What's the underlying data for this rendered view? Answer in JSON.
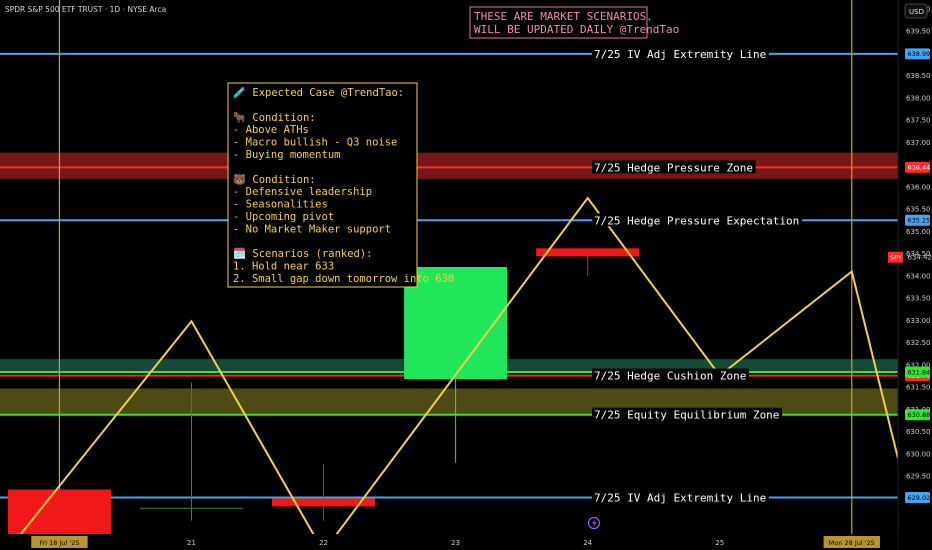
{
  "header": {
    "symbol_title": "SPDR S&P 500 ETF TRUST · 1D · NYSE Arca",
    "currency": "USD"
  },
  "banner": {
    "lines": [
      "THESE ARE MARKET SCENARIOS.",
      "WILL BE UPDATED DAILY @TrendTao"
    ]
  },
  "note": {
    "lines": [
      "🧪 Expected Case @TrendTao:",
      "",
      "🐂 Condition:",
      "- Above ATHs",
      "- Macro bullish - Q3 noise",
      "- Buying momentum",
      "",
      "🐻 Condition:",
      "- Defensive leadership",
      "- Seasonalities",
      "- Upcoming pivot",
      "- No Market Maker support",
      "",
      "🗓️ Scenarios (ranked):",
      "1. Hold near 633",
      "2. Small gap down tomorrow into 630"
    ]
  },
  "colors": {
    "background": "#000000",
    "extremity_line": "#42a5f5",
    "hedge_zone_fill": "#8b1a1a",
    "hedge_line": "#ff2a2a",
    "cushion_fill": "#1f6b55",
    "equilibrium_fill": "#6f6a1c",
    "green_line": "#2ee82e",
    "path": "#f2d04a",
    "bull_candle": "#22e65a",
    "bear_candle": "#f01818",
    "note_border": "#f2d04a",
    "banner_border": "#e07aa8",
    "vline": "#c8a42a"
  },
  "chart_data": {
    "type": "scenario_chart",
    "ylim": [
      628.2,
      640.2
    ],
    "x_ticks": [
      {
        "label": "Fri 18 Jul '25",
        "x": 0,
        "highlight": true
      },
      {
        "label": "21",
        "x": 1
      },
      {
        "label": "22",
        "x": 2
      },
      {
        "label": "23",
        "x": 3
      },
      {
        "label": "24",
        "x": 4
      },
      {
        "label": "25",
        "x": 5
      },
      {
        "label": "Mon 28 Jul '25",
        "x": 6,
        "highlight": true
      }
    ],
    "xlim": [
      -0.45,
      6.35
    ],
    "y_ticks": [
      629.0,
      629.5,
      630.0,
      630.5,
      631.0,
      631.5,
      632.0,
      632.5,
      633.0,
      633.5,
      634.0,
      634.5,
      635.0,
      635.5,
      636.0,
      636.5,
      637.0,
      637.5,
      638.0,
      638.5,
      639.0,
      639.5,
      640.0
    ],
    "y_tick_labels": [
      "629.00",
      "629.50",
      "630.00",
      "630.50",
      "631.00",
      "631.50",
      "632.00",
      "632.50",
      "633.00",
      "633.50",
      "634.00",
      "634.50",
      "635.00",
      "635.50",
      "636.00",
      "636.50",
      "637.00",
      "637.50",
      "638.00",
      "638.50",
      "639.00",
      "639.50",
      "640.00"
    ],
    "levels": [
      {
        "name": "7/25 IV Adj Extremity Line",
        "value": 638.99,
        "label": "638.99",
        "kind": "extremity"
      },
      {
        "name": "7/25 Hedge Pressure Zone",
        "value": 636.44,
        "label": "636.44",
        "kind": "hedge_line"
      },
      {
        "name": "7/25 Hedge Pressure Expectation",
        "value": 635.25,
        "label": "635.25",
        "kind": "extremity"
      },
      {
        "name": "7/25 Hedge Cushion Zone",
        "value": 631.76,
        "label": "631.76",
        "kind": "hedge_line"
      },
      {
        "name": "7/25 Equity Equilibrium Zone",
        "value": 630.88,
        "label": "630.88",
        "kind": "green"
      },
      {
        "name": "7/25 IV Adj Extremity Line",
        "value": 629.02,
        "label": "629.02",
        "kind": "extremity"
      }
    ],
    "green_line_upper": {
      "value": 631.84,
      "label": "631.84"
    },
    "zones": [
      {
        "name": "hedge-pressure-zone",
        "low": 636.18,
        "high": 636.77,
        "kind": "hedge"
      },
      {
        "name": "hedge-cushion-zone",
        "low": 631.84,
        "high": 632.13,
        "kind": "cushion"
      },
      {
        "name": "equity-equilibrium-zone",
        "low": 630.88,
        "high": 631.47,
        "kind": "equilibrium"
      }
    ],
    "last_price": {
      "symbol": "SPY",
      "value": 634.42,
      "label": "634.42"
    },
    "candles": [
      {
        "x": 0,
        "open": 629.2,
        "close": 628.1,
        "high": 629.2,
        "low": 628.1,
        "dir": "down"
      },
      {
        "x": 1,
        "open": 628.78,
        "close": 628.78,
        "high": 631.6,
        "low": 628.5,
        "dir": "doji"
      },
      {
        "x": 2,
        "open": 629.0,
        "close": 628.82,
        "high": 629.78,
        "low": 628.5,
        "dir": "down"
      },
      {
        "x": 3,
        "open": 631.68,
        "close": 634.2,
        "high": 634.2,
        "low": 629.8,
        "dir": "up"
      },
      {
        "x": 4,
        "open": 634.62,
        "close": 634.44,
        "high": 634.62,
        "low": 634.0,
        "dir": "down"
      }
    ],
    "scenario_path": [
      {
        "x": -0.4,
        "y": 627.8
      },
      {
        "x": 1.0,
        "y": 632.98
      },
      {
        "x": 2.0,
        "y": 627.8
      },
      {
        "x": 4.0,
        "y": 635.75
      },
      {
        "x": 5.0,
        "y": 631.76
      },
      {
        "x": 6.0,
        "y": 634.1
      },
      {
        "x": 6.35,
        "y": 629.9
      }
    ],
    "vertical_markers": [
      0,
      6
    ]
  }
}
